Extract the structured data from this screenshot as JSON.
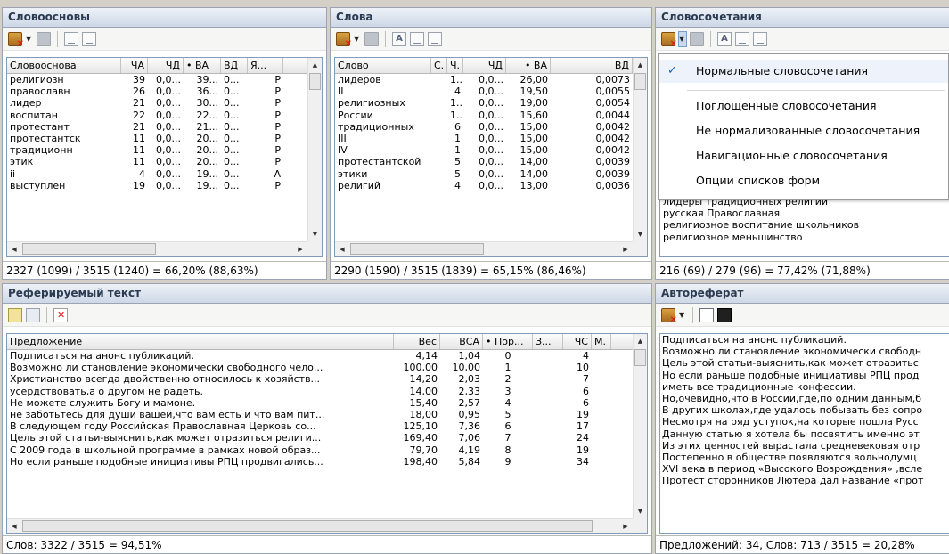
{
  "words_stems": {
    "title": "Словоосновы",
    "columns": [
      "Словооснова",
      "ЧА",
      "ЧД",
      "• ВА",
      "ВД",
      "Я..."
    ],
    "rows": [
      [
        "религиозн",
        "39",
        "0,0...",
        "39...",
        "0...",
        "Р"
      ],
      [
        "православн",
        "26",
        "0,0...",
        "36...",
        "0...",
        "Р"
      ],
      [
        "лидер",
        "21",
        "0,0...",
        "30...",
        "0...",
        "Р"
      ],
      [
        "воспитан",
        "22",
        "0,0...",
        "22...",
        "0...",
        "Р"
      ],
      [
        "протестант",
        "21",
        "0,0...",
        "21...",
        "0...",
        "Р"
      ],
      [
        "протестантск",
        "11",
        "0,0...",
        "20...",
        "0...",
        "Р"
      ],
      [
        "традиционн",
        "11",
        "0,0...",
        "20...",
        "0...",
        "Р"
      ],
      [
        "этик",
        "11",
        "0,0...",
        "20...",
        "0...",
        "Р"
      ],
      [
        "ii",
        "4",
        "0,0...",
        "19...",
        "0...",
        "А"
      ],
      [
        "выступлен",
        "19",
        "0,0...",
        "19...",
        "0...",
        "Р"
      ]
    ],
    "status": "2327 (1099) / 3515 (1240) = 66,20% (88,63%)"
  },
  "words": {
    "title": "Слова",
    "columns": [
      "Слово",
      "С.",
      "Ч.",
      "ЧД",
      "• ВА",
      "ВД"
    ],
    "rows": [
      [
        "лидеров",
        "",
        "1...",
        "0,0...",
        "26,00",
        "0,0073"
      ],
      [
        "II",
        "",
        "4",
        "0,0...",
        "19,50",
        "0,0055"
      ],
      [
        "религиозных",
        "",
        "1...",
        "0,0...",
        "19,00",
        "0,0054"
      ],
      [
        "России",
        "",
        "1...",
        "0,0...",
        "15,60",
        "0,0044"
      ],
      [
        "традиционных",
        "",
        "6",
        "0,0...",
        "15,00",
        "0,0042"
      ],
      [
        "III",
        "",
        "1",
        "0,0...",
        "15,00",
        "0,0042"
      ],
      [
        "IV",
        "",
        "1",
        "0,0...",
        "15,00",
        "0,0042"
      ],
      [
        "протестантской",
        "",
        "5",
        "0,0...",
        "14,00",
        "0,0039"
      ],
      [
        "этики",
        "",
        "5",
        "0,0...",
        "14,00",
        "0,0039"
      ],
      [
        "религий",
        "",
        "4",
        "0,0...",
        "13,00",
        "0,0036"
      ]
    ],
    "status": "2290 (1590) / 3515 (1839) = 65,15% (86,46%)"
  },
  "collocations": {
    "title": "Словосочетания",
    "visible_rows": [
      "лидеры традиционных религий",
      "русская Православная",
      "религиозное воспитание школьников",
      "религиозное меньшинство"
    ],
    "status": "216 (69) / 279 (96) = 77,42% (71,88%)",
    "menu": {
      "checkmark": "✓",
      "items": [
        "Нормальные словосочетания",
        "Поглощенные словосочетания",
        "Не нормализованные словосочетания",
        "Навигационные словосочетания",
        "Опции списков форм"
      ]
    }
  },
  "ref_text": {
    "title": "Реферируемый текст",
    "columns": [
      "Предложение",
      "Вес",
      "ВСА",
      "• Пор...",
      "З...",
      "ЧС",
      "М."
    ],
    "rows": [
      [
        "Подписаться на анонс публикаций.",
        "4,14",
        "1,04",
        "0",
        "",
        "4",
        ""
      ],
      [
        "Возможно ли становление экономически свободного чело...",
        "100,00",
        "10,00",
        "1",
        "",
        "10",
        ""
      ],
      [
        "Христианство всегда двойственно относилось к хозяйств...",
        "14,20",
        "2,03",
        "2",
        "",
        "7",
        ""
      ],
      [
        "усердствовать,а о другом не радеть.",
        "14,00",
        "2,33",
        "3",
        "",
        "6",
        ""
      ],
      [
        "Не можете служить Богу и мамоне.",
        "15,40",
        "2,57",
        "4",
        "",
        "6",
        ""
      ],
      [
        "не заботьтесь для души вашей,что вам есть и что вам пит...",
        "18,00",
        "0,95",
        "5",
        "",
        "19",
        ""
      ],
      [
        "В следующем году Российская Православная Церковь со...",
        "125,10",
        "7,36",
        "6",
        "",
        "17",
        ""
      ],
      [
        "Цель этой статьи-выяснить,как может отразиться религи...",
        "169,40",
        "7,06",
        "7",
        "",
        "24",
        ""
      ],
      [
        "С 2009 года в школьной программе в рамках новой образ...",
        "79,70",
        "4,19",
        "8",
        "",
        "19",
        ""
      ],
      [
        "Но если раньше подобные инициативы РПЦ продвигались...",
        "198,40",
        "5,84",
        "9",
        "",
        "34",
        ""
      ]
    ],
    "status": "Слов: 3322 / 3515 = 94,51%"
  },
  "abstract": {
    "title": "Автореферат",
    "lines": [
      "Подписаться на анонс публикаций.",
      "Возможно ли становление экономически свободн",
      "Цель этой статьи-выяснить,как может отразитьс",
      "Но если раньше подобные инициативы РПЦ прод",
      "иметь все традиционные конфессии.",
      "Но,очевидно,что в России,где,по одним данным,б",
      "В других школах,где удалось побывать без сопро",
      "Несмотря на ряд уступок,на которые пошла Русс",
      "Данную статью я хотела бы посвятить именно эт",
      "Из этих ценностей вырастала средневековая отр",
      "Постепенно в обществе появляются вольнодумц",
      "XVI века в период «Высокого Возрождения» ,всле",
      "Протест сторонников Лютера дал название «прот"
    ],
    "status": "Предложений: 34, Слов: 713 / 3515 = 20,28%"
  }
}
